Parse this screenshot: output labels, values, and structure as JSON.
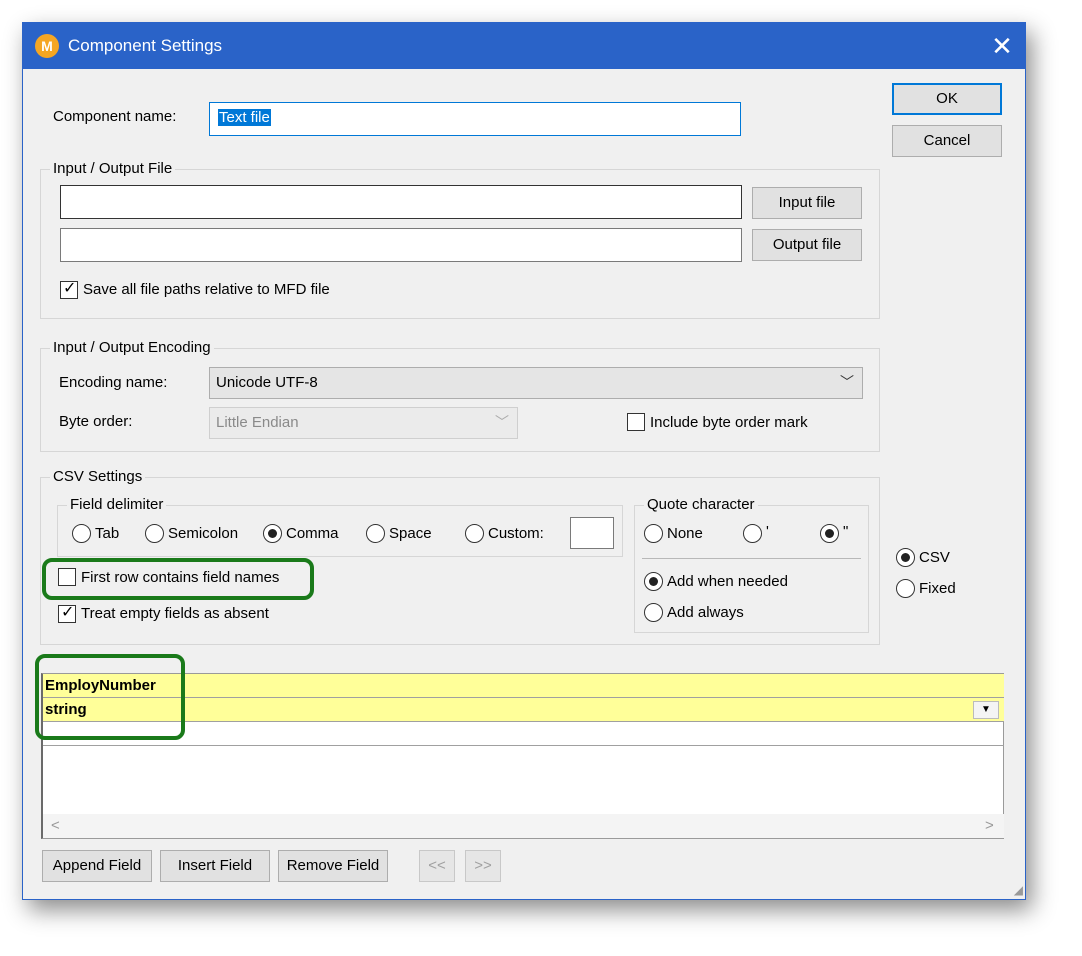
{
  "window": {
    "title": "Component Settings",
    "app_icon": "altova-mapforce-icon",
    "close_glyph": "✕"
  },
  "buttons": {
    "ok": "OK",
    "cancel": "Cancel",
    "input_file": "Input file",
    "output_file": "Output file",
    "append_field": "Append Field",
    "insert_field": "Insert Field",
    "remove_field": "Remove Field",
    "prev": "<<",
    "next": ">>"
  },
  "component": {
    "name_label": "Component name:",
    "name_value": "Text file"
  },
  "io_file": {
    "group_title": "Input / Output File",
    "input_path": "",
    "output_path": "",
    "save_relative_label": "Save all file paths relative to MFD file",
    "save_relative_checked": true
  },
  "encoding": {
    "group_title": "Input / Output Encoding",
    "encoding_label": "Encoding name:",
    "encoding_value": "Unicode UTF-8",
    "byte_order_label": "Byte order:",
    "byte_order_value": "Little Endian",
    "bom_label": "Include byte order mark",
    "bom_checked": false
  },
  "csv": {
    "group_title": "CSV Settings",
    "delimiter_title": "Field delimiter",
    "delimiters": [
      "Tab",
      "Semicolon",
      "Comma",
      "Space",
      "Custom:"
    ],
    "selected_delimiter": "Comma",
    "custom_value": "",
    "quote_title": "Quote character",
    "quote_none": "None",
    "quote_single": "'",
    "quote_double": "\"",
    "selected_quote": "\"",
    "add_when_needed": "Add when needed",
    "add_always": "Add always",
    "selected_add": "Add when needed",
    "first_row_label": "First row contains field names",
    "first_row_checked": false,
    "treat_empty_label": "Treat empty fields as absent",
    "treat_empty_checked": true
  },
  "format": {
    "csv": "CSV",
    "fixed": "Fixed",
    "selected": "CSV"
  },
  "grid": {
    "field_name": "EmployNumber",
    "field_type": "string",
    "scroll_left": "<",
    "scroll_right": ">"
  },
  "colors": {
    "titlebar": "#2a63c8",
    "highlight": "#1a7a1a",
    "grid_row": "#ffff99"
  }
}
